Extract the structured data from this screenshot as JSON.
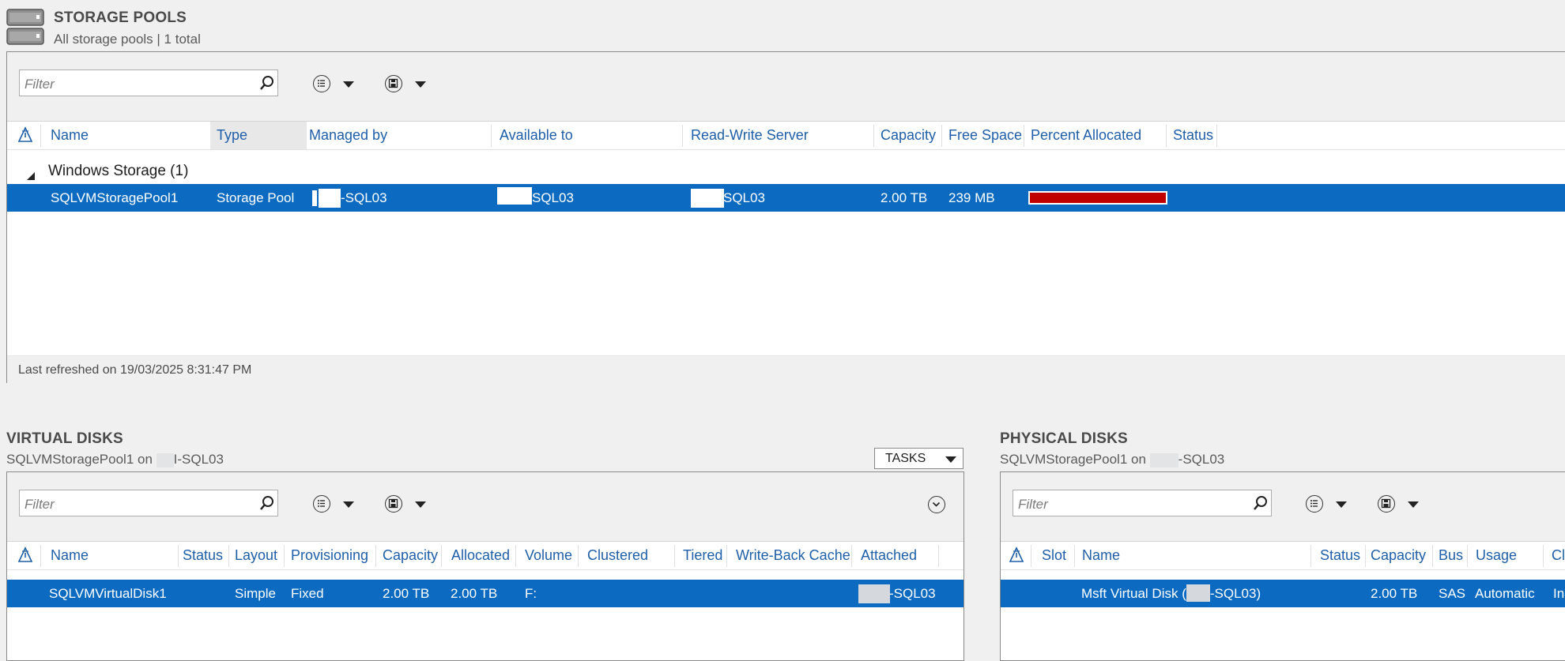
{
  "storage_pools": {
    "title": "STORAGE POOLS",
    "subtitle": "All storage pools | 1 total",
    "filter_placeholder": "Filter",
    "columns": [
      "Name",
      "Type",
      "Managed by",
      "Available to",
      "Read-Write Server",
      "Capacity",
      "Free Space",
      "Percent Allocated",
      "Status"
    ],
    "group_label": "Windows Storage (1)",
    "row": {
      "name": "SQLVMStoragePool1",
      "type": "Storage Pool",
      "managed_by": "-SQL03",
      "available_to": "SQL03",
      "read_write_server": "SQL03",
      "capacity": "2.00 TB",
      "free_space": "239 MB",
      "percent_allocated": 0.9999,
      "percent_bar_color": "#c00000"
    },
    "last_refreshed": "Last refreshed on 19/03/2025 8:31:47 PM"
  },
  "virtual_disks": {
    "title": "VIRTUAL DISKS",
    "subtitle_prefix": "SQLVMStoragePool1 on",
    "subtitle_suffix": "I-SQL03",
    "tasks_label": "TASKS",
    "filter_placeholder": "Filter",
    "columns": [
      "Name",
      "Status",
      "Layout",
      "Provisioning",
      "Capacity",
      "Allocated",
      "Volume",
      "Clustered",
      "Tiered",
      "Write-Back Cache",
      "Attached"
    ],
    "row": {
      "name": "SQLVMVirtualDisk1",
      "status": "",
      "layout": "Simple",
      "provisioning": "Fixed",
      "capacity": "2.00 TB",
      "allocated": "2.00 TB",
      "volume": "F:",
      "attached": "-SQL03"
    }
  },
  "physical_disks": {
    "title": "PHYSICAL DISKS",
    "subtitle_prefix": "SQLVMStoragePool1 on",
    "subtitle_suffix": "-SQL03",
    "filter_placeholder": "Filter",
    "columns": [
      "Slot",
      "Name",
      "Status",
      "Capacity",
      "Bus",
      "Usage",
      "Cl"
    ],
    "row": {
      "name_prefix": "Msft Virtual Disk (",
      "name_suffix": "-SQL03)",
      "capacity": "2.00 TB",
      "bus": "SAS",
      "usage": "Automatic",
      "chassis": "In"
    }
  },
  "colors": {
    "selection": "#0c6bc1",
    "header_text": "#1f5fa8",
    "panel_bg": "#f0f0f0"
  },
  "icons": [
    "server-icon",
    "search-icon",
    "list-view-icon",
    "save-icon",
    "warning-sort-icon",
    "collapse-triangle-icon",
    "expand-icon"
  ]
}
